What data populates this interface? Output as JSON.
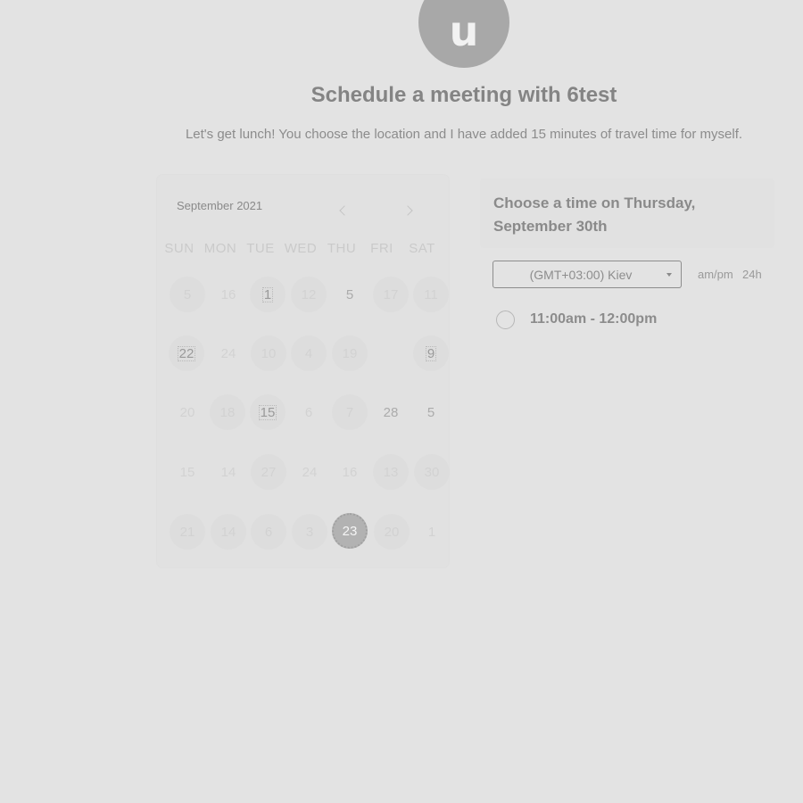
{
  "avatar": {
    "initial": "u"
  },
  "title": "Schedule a meeting with 6test",
  "description": "Let's get lunch! You choose the location and I have added 15 minutes of travel time for myself.",
  "calendar": {
    "month_label": "September 2021",
    "prev_icon": "chevron-left-icon",
    "next_icon": "chevron-right-icon",
    "weekdays": [
      "SUN",
      "MON",
      "TUE",
      "WED",
      "THU",
      "FRI",
      "SAT"
    ],
    "rows": [
      [
        "5",
        "16",
        "1",
        "12",
        "5",
        "17",
        "11"
      ],
      [
        "22",
        "24",
        "10",
        "4",
        "19",
        "",
        "9"
      ],
      [
        "20",
        "18",
        "15",
        "6",
        "7",
        "28",
        "5"
      ],
      [
        "15",
        "14",
        "27",
        "24",
        "16",
        "13",
        "30"
      ],
      [
        "21",
        "14",
        "6",
        "3",
        "23",
        "20",
        "1"
      ]
    ],
    "selected": "23"
  },
  "time_panel": {
    "heading": "Choose a time on Thursday, September 30th",
    "timezone": "(GMT+03:00) Kiev",
    "format_ampm": "am/pm",
    "format_24h": "24h",
    "slots": [
      {
        "label": "11:00am - 12:00pm"
      }
    ]
  }
}
